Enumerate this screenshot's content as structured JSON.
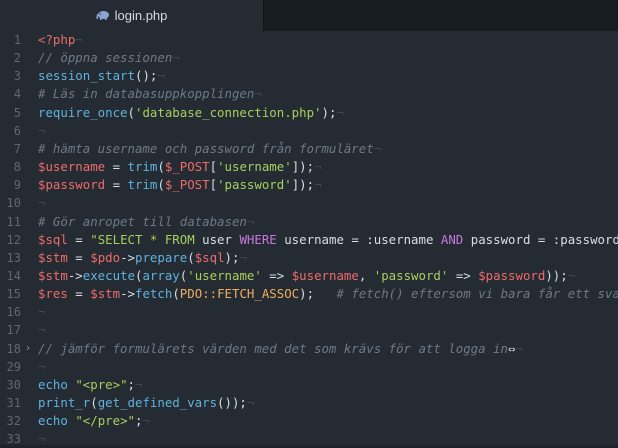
{
  "tab": {
    "title": "login.php",
    "icon": "php-elephant-icon"
  },
  "colors": {
    "background": "#242b33",
    "tabbar": "#171c21",
    "comment": "#6d7a86",
    "function": "#5fb3dd",
    "variable": "#ef6b6b",
    "string": "#a8cf5d",
    "keyword": "#c678dd",
    "constant": "#f0ad5d"
  },
  "lines": [
    {
      "num": "1",
      "tokens": [
        {
          "t": "php",
          "v": "<?php"
        },
        {
          "t": "ws",
          "v": "¬"
        }
      ]
    },
    {
      "num": "2",
      "tokens": [
        {
          "t": "comment",
          "v": "// öppna sessionen"
        },
        {
          "t": "ws",
          "v": "¬"
        }
      ]
    },
    {
      "num": "3",
      "tokens": [
        {
          "t": "func",
          "v": "session_start"
        },
        {
          "t": "plain",
          "v": "();"
        },
        {
          "t": "ws",
          "v": "¬"
        }
      ]
    },
    {
      "num": "4",
      "tokens": [
        {
          "t": "comment",
          "v": "# Läs in databasuppkopplingen"
        },
        {
          "t": "ws",
          "v": "¬"
        }
      ]
    },
    {
      "num": "5",
      "tokens": [
        {
          "t": "func",
          "v": "require_once"
        },
        {
          "t": "plain",
          "v": "("
        },
        {
          "t": "str",
          "v": "'database_connection.php'"
        },
        {
          "t": "plain",
          "v": ");"
        },
        {
          "t": "ws",
          "v": "¬"
        }
      ]
    },
    {
      "num": "6",
      "tokens": [
        {
          "t": "ws",
          "v": "¬"
        }
      ]
    },
    {
      "num": "7",
      "tokens": [
        {
          "t": "comment",
          "v": "# hämta username och password från formuläret"
        },
        {
          "t": "ws",
          "v": "¬"
        }
      ]
    },
    {
      "num": "8",
      "tokens": [
        {
          "t": "var",
          "v": "$username"
        },
        {
          "t": "plain",
          "v": " = "
        },
        {
          "t": "func",
          "v": "trim"
        },
        {
          "t": "plain",
          "v": "("
        },
        {
          "t": "var",
          "v": "$_POST"
        },
        {
          "t": "plain",
          "v": "["
        },
        {
          "t": "str",
          "v": "'username'"
        },
        {
          "t": "plain",
          "v": "]);"
        },
        {
          "t": "ws",
          "v": "¬"
        }
      ]
    },
    {
      "num": "9",
      "tokens": [
        {
          "t": "var",
          "v": "$password"
        },
        {
          "t": "plain",
          "v": " = "
        },
        {
          "t": "func",
          "v": "trim"
        },
        {
          "t": "plain",
          "v": "("
        },
        {
          "t": "var",
          "v": "$_POST"
        },
        {
          "t": "plain",
          "v": "["
        },
        {
          "t": "str",
          "v": "'password'"
        },
        {
          "t": "plain",
          "v": "]);"
        },
        {
          "t": "ws",
          "v": "¬"
        }
      ]
    },
    {
      "num": "10",
      "tokens": [
        {
          "t": "ws",
          "v": "¬"
        }
      ]
    },
    {
      "num": "11",
      "tokens": [
        {
          "t": "comment",
          "v": "# Gör anropet till databasen"
        },
        {
          "t": "ws",
          "v": "¬"
        }
      ]
    },
    {
      "num": "12",
      "tokens": [
        {
          "t": "var",
          "v": "$sql"
        },
        {
          "t": "plain",
          "v": " = "
        },
        {
          "t": "str",
          "v": "\"SELECT * FROM "
        },
        {
          "t": "plain",
          "v": "user "
        },
        {
          "t": "kw",
          "v": "WHERE"
        },
        {
          "t": "plain",
          "v": " username = :username "
        },
        {
          "t": "kw",
          "v": "AND"
        },
        {
          "t": "plain",
          "v": " password = :password\";"
        }
      ]
    },
    {
      "num": "13",
      "tokens": [
        {
          "t": "var",
          "v": "$stm"
        },
        {
          "t": "plain",
          "v": " = "
        },
        {
          "t": "var",
          "v": "$pdo"
        },
        {
          "t": "plain",
          "v": "->"
        },
        {
          "t": "func",
          "v": "prepare"
        },
        {
          "t": "plain",
          "v": "("
        },
        {
          "t": "var",
          "v": "$sql"
        },
        {
          "t": "plain",
          "v": ");"
        },
        {
          "t": "ws",
          "v": "¬"
        }
      ]
    },
    {
      "num": "14",
      "tokens": [
        {
          "t": "var",
          "v": "$stm"
        },
        {
          "t": "plain",
          "v": "->"
        },
        {
          "t": "func",
          "v": "execute"
        },
        {
          "t": "plain",
          "v": "("
        },
        {
          "t": "func",
          "v": "array"
        },
        {
          "t": "plain",
          "v": "("
        },
        {
          "t": "str",
          "v": "'username'"
        },
        {
          "t": "plain",
          "v": " => "
        },
        {
          "t": "var",
          "v": "$username"
        },
        {
          "t": "plain",
          "v": ", "
        },
        {
          "t": "str",
          "v": "'password'"
        },
        {
          "t": "plain",
          "v": " => "
        },
        {
          "t": "var",
          "v": "$password"
        },
        {
          "t": "plain",
          "v": "));"
        },
        {
          "t": "ws",
          "v": "¬"
        }
      ]
    },
    {
      "num": "15",
      "tokens": [
        {
          "t": "var",
          "v": "$res"
        },
        {
          "t": "plain",
          "v": " = "
        },
        {
          "t": "var",
          "v": "$stm"
        },
        {
          "t": "plain",
          "v": "->"
        },
        {
          "t": "func",
          "v": "fetch"
        },
        {
          "t": "plain",
          "v": "("
        },
        {
          "t": "const",
          "v": "PDO::FETCH_ASSOC"
        },
        {
          "t": "plain",
          "v": ");   "
        },
        {
          "t": "comment",
          "v": "# fetch() eftersom vi bara får ett svar"
        }
      ]
    },
    {
      "num": "16",
      "tokens": [
        {
          "t": "ws",
          "v": "¬"
        }
      ]
    },
    {
      "num": "17",
      "tokens": [
        {
          "t": "ws",
          "v": "¬"
        }
      ]
    },
    {
      "num": "18",
      "fold": "›",
      "tokens": [
        {
          "t": "comment",
          "v": "// jämför formulärets värden med det som krävs för att logga in"
        },
        {
          "t": "cursor",
          "v": "⇔"
        },
        {
          "t": "ws",
          "v": "¬"
        }
      ]
    },
    {
      "num": "29",
      "tokens": [
        {
          "t": "ws",
          "v": "¬"
        }
      ]
    },
    {
      "num": "30",
      "tokens": [
        {
          "t": "func",
          "v": "echo"
        },
        {
          "t": "plain",
          "v": " "
        },
        {
          "t": "str",
          "v": "\"<pre>\""
        },
        {
          "t": "plain",
          "v": ";"
        },
        {
          "t": "ws",
          "v": "¬"
        }
      ]
    },
    {
      "num": "31",
      "tokens": [
        {
          "t": "func",
          "v": "print_r"
        },
        {
          "t": "plain",
          "v": "("
        },
        {
          "t": "func",
          "v": "get_defined_vars"
        },
        {
          "t": "plain",
          "v": "());"
        },
        {
          "t": "ws",
          "v": "¬"
        }
      ]
    },
    {
      "num": "32",
      "tokens": [
        {
          "t": "func",
          "v": "echo"
        },
        {
          "t": "plain",
          "v": " "
        },
        {
          "t": "str",
          "v": "\"</pre>\""
        },
        {
          "t": "plain",
          "v": ";"
        },
        {
          "t": "ws",
          "v": "¬"
        }
      ]
    },
    {
      "num": "33",
      "tokens": [
        {
          "t": "ws",
          "v": "¬"
        }
      ]
    }
  ]
}
